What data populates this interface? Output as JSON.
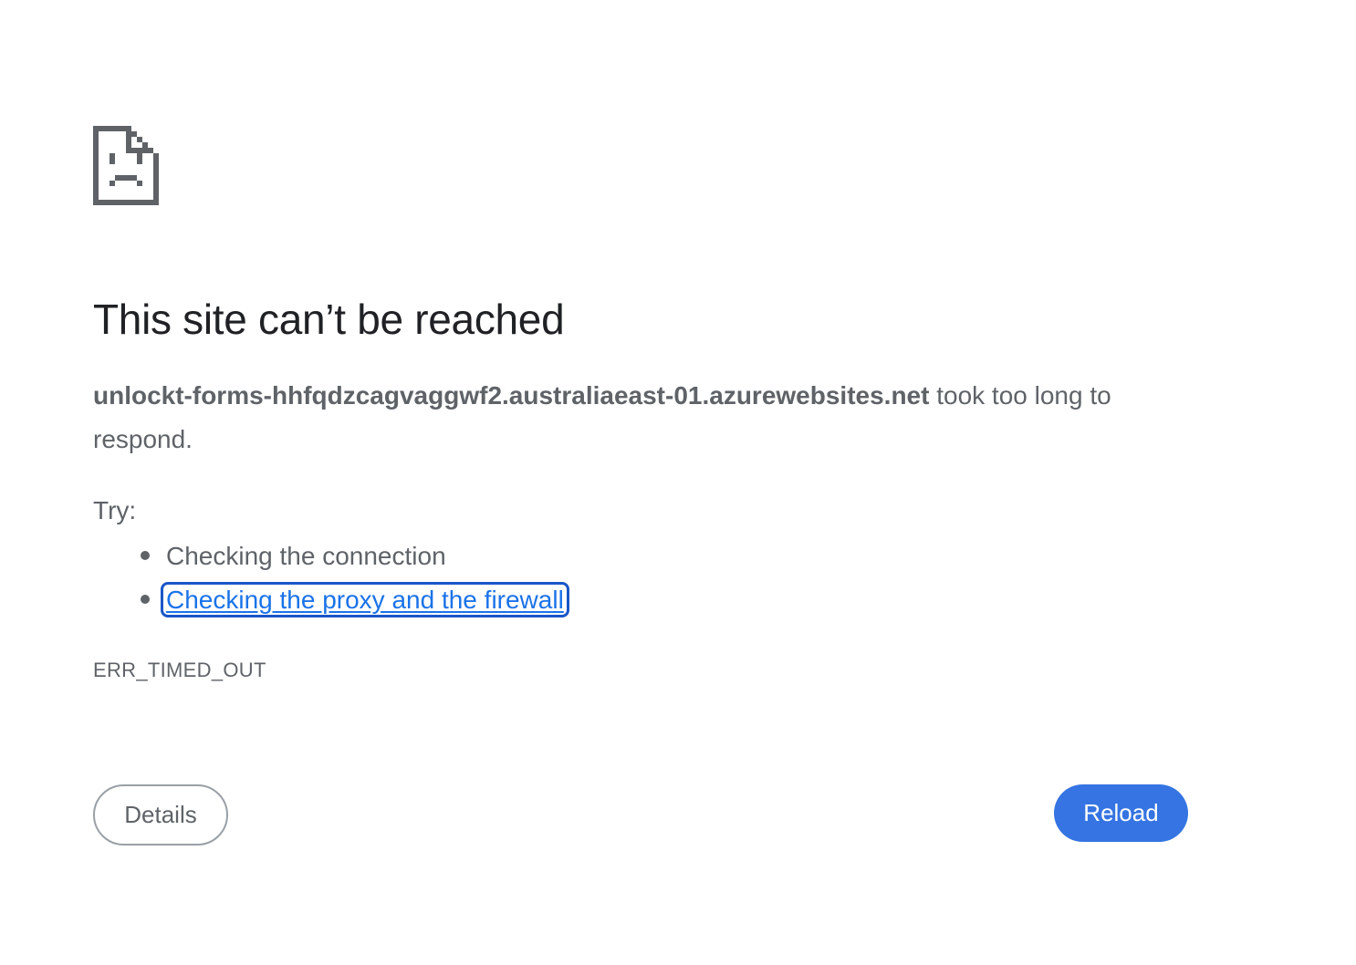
{
  "error_page": {
    "icon": "sad-page-icon",
    "title": "This site can’t be reached",
    "host": "unlockt-forms-hhfqdzcagvaggwf2.australiaeast-01.azurewebsites.net",
    "summary_suffix": " took too long to respond.",
    "try_label": "Try:",
    "suggestions": [
      {
        "label": "Checking the connection",
        "link": false
      },
      {
        "label": "Checking the proxy and the firewall",
        "link": true
      }
    ],
    "error_code": "ERR_TIMED_OUT",
    "details_button": "Details",
    "reload_button": "Reload"
  },
  "colors": {
    "text": "#5f6368",
    "title": "#202124",
    "link": "#1a73e8",
    "reload_bg": "#3574e2"
  }
}
